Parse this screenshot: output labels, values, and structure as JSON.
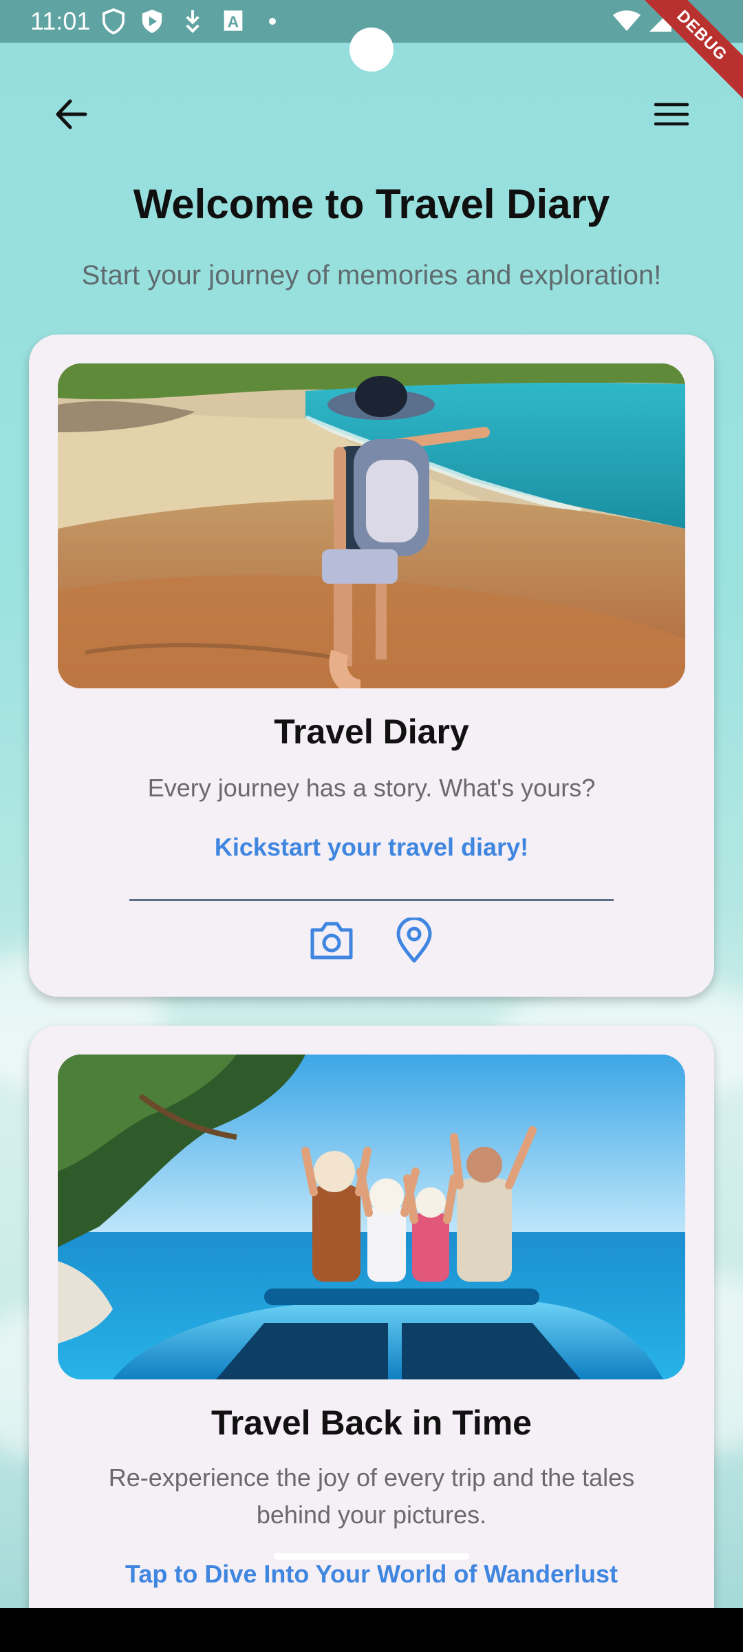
{
  "status_bar": {
    "time": "11:01",
    "left_icons": [
      "shield-icon",
      "play-protect-icon",
      "download-icon",
      "a-icon",
      "dot-icon"
    ],
    "right_icons": [
      "wifi-icon",
      "signal-icon",
      "battery-icon"
    ],
    "debug_label": "DEBUG"
  },
  "app_bar": {
    "back_icon": "arrow-back-icon",
    "menu_icon": "hamburger-menu-icon"
  },
  "header": {
    "title": "Welcome to Travel Diary",
    "subtitle": "Start your journey of memories and exploration!"
  },
  "cards": [
    {
      "title": "Travel Diary",
      "description": "Every journey has a story. What's yours?",
      "link": "Kickstart your travel diary!",
      "icons": [
        "camera-icon",
        "location-pin-icon"
      ]
    },
    {
      "title": "Travel Back in Time",
      "description": "Re-experience the joy of every trip and the tales behind your pictures.",
      "link": "Tap to Dive Into Your World of Wanderlust"
    }
  ],
  "colors": {
    "accent": "#3f86e0",
    "card_bg": "#f5eff6",
    "status_bar": "#5fa3a2",
    "debug_ribbon": "#b8312f"
  }
}
